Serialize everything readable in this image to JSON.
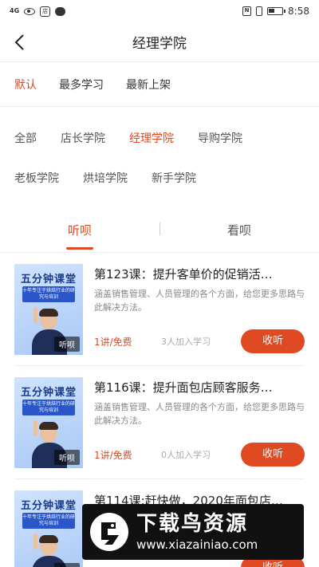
{
  "status_bar": {
    "signal_text": "4G",
    "app_badge": "店",
    "time": "8:58"
  },
  "nav": {
    "title": "经理学院",
    "back_icon": "back-arrow-icon"
  },
  "sort_tabs": [
    {
      "label": "默认",
      "active": true
    },
    {
      "label": "最多学习",
      "active": false
    },
    {
      "label": "最新上架",
      "active": false
    }
  ],
  "categories": [
    [
      {
        "label": "全部",
        "active": false
      },
      {
        "label": "店长学院",
        "active": false
      },
      {
        "label": "经理学院",
        "active": true
      },
      {
        "label": "导购学院",
        "active": false
      }
    ],
    [
      {
        "label": "老板学院",
        "active": false
      },
      {
        "label": "烘培学院",
        "active": false
      },
      {
        "label": "新手学院",
        "active": false
      }
    ]
  ],
  "media_tabs": [
    {
      "label": "听呗",
      "active": true
    },
    {
      "label": "看呗",
      "active": false
    }
  ],
  "courses": [
    {
      "thumb_title": "五分钟课堂",
      "thumb_sub": "十年专注于烘焙行业的研究与培训",
      "thumb_badge": "听呗",
      "title": "第123课：提升客单价的促销活…",
      "desc": "涵盖销售管理、人员管理的各个方面，给您更多思路与此解决方法。",
      "price": "1讲/免费",
      "count": "3人加入学习",
      "button": "收听"
    },
    {
      "thumb_title": "五分钟课堂",
      "thumb_sub": "十年专注于烘焙行业的研究与培训",
      "thumb_badge": "听呗",
      "title": "第116课：提升面包店顾客服务…",
      "desc": "涵盖销售管理、人员管理的各个方面，给您更多思路与此解决方法。",
      "price": "1讲/免费",
      "count": "0人加入学习",
      "button": "收听"
    },
    {
      "thumb_title": "五分钟课堂",
      "thumb_sub": "十年专注于烘焙行业的研究与培训",
      "thumb_badge": "听呗",
      "title": "第114课:赶快做，2020年面包店…",
      "desc": "",
      "price": "",
      "count": "",
      "button": "收听"
    }
  ],
  "watermark": {
    "main": "下载鸟资源",
    "url": "www.xiazainiao.com"
  },
  "colors": {
    "accent": "#e04a22"
  }
}
